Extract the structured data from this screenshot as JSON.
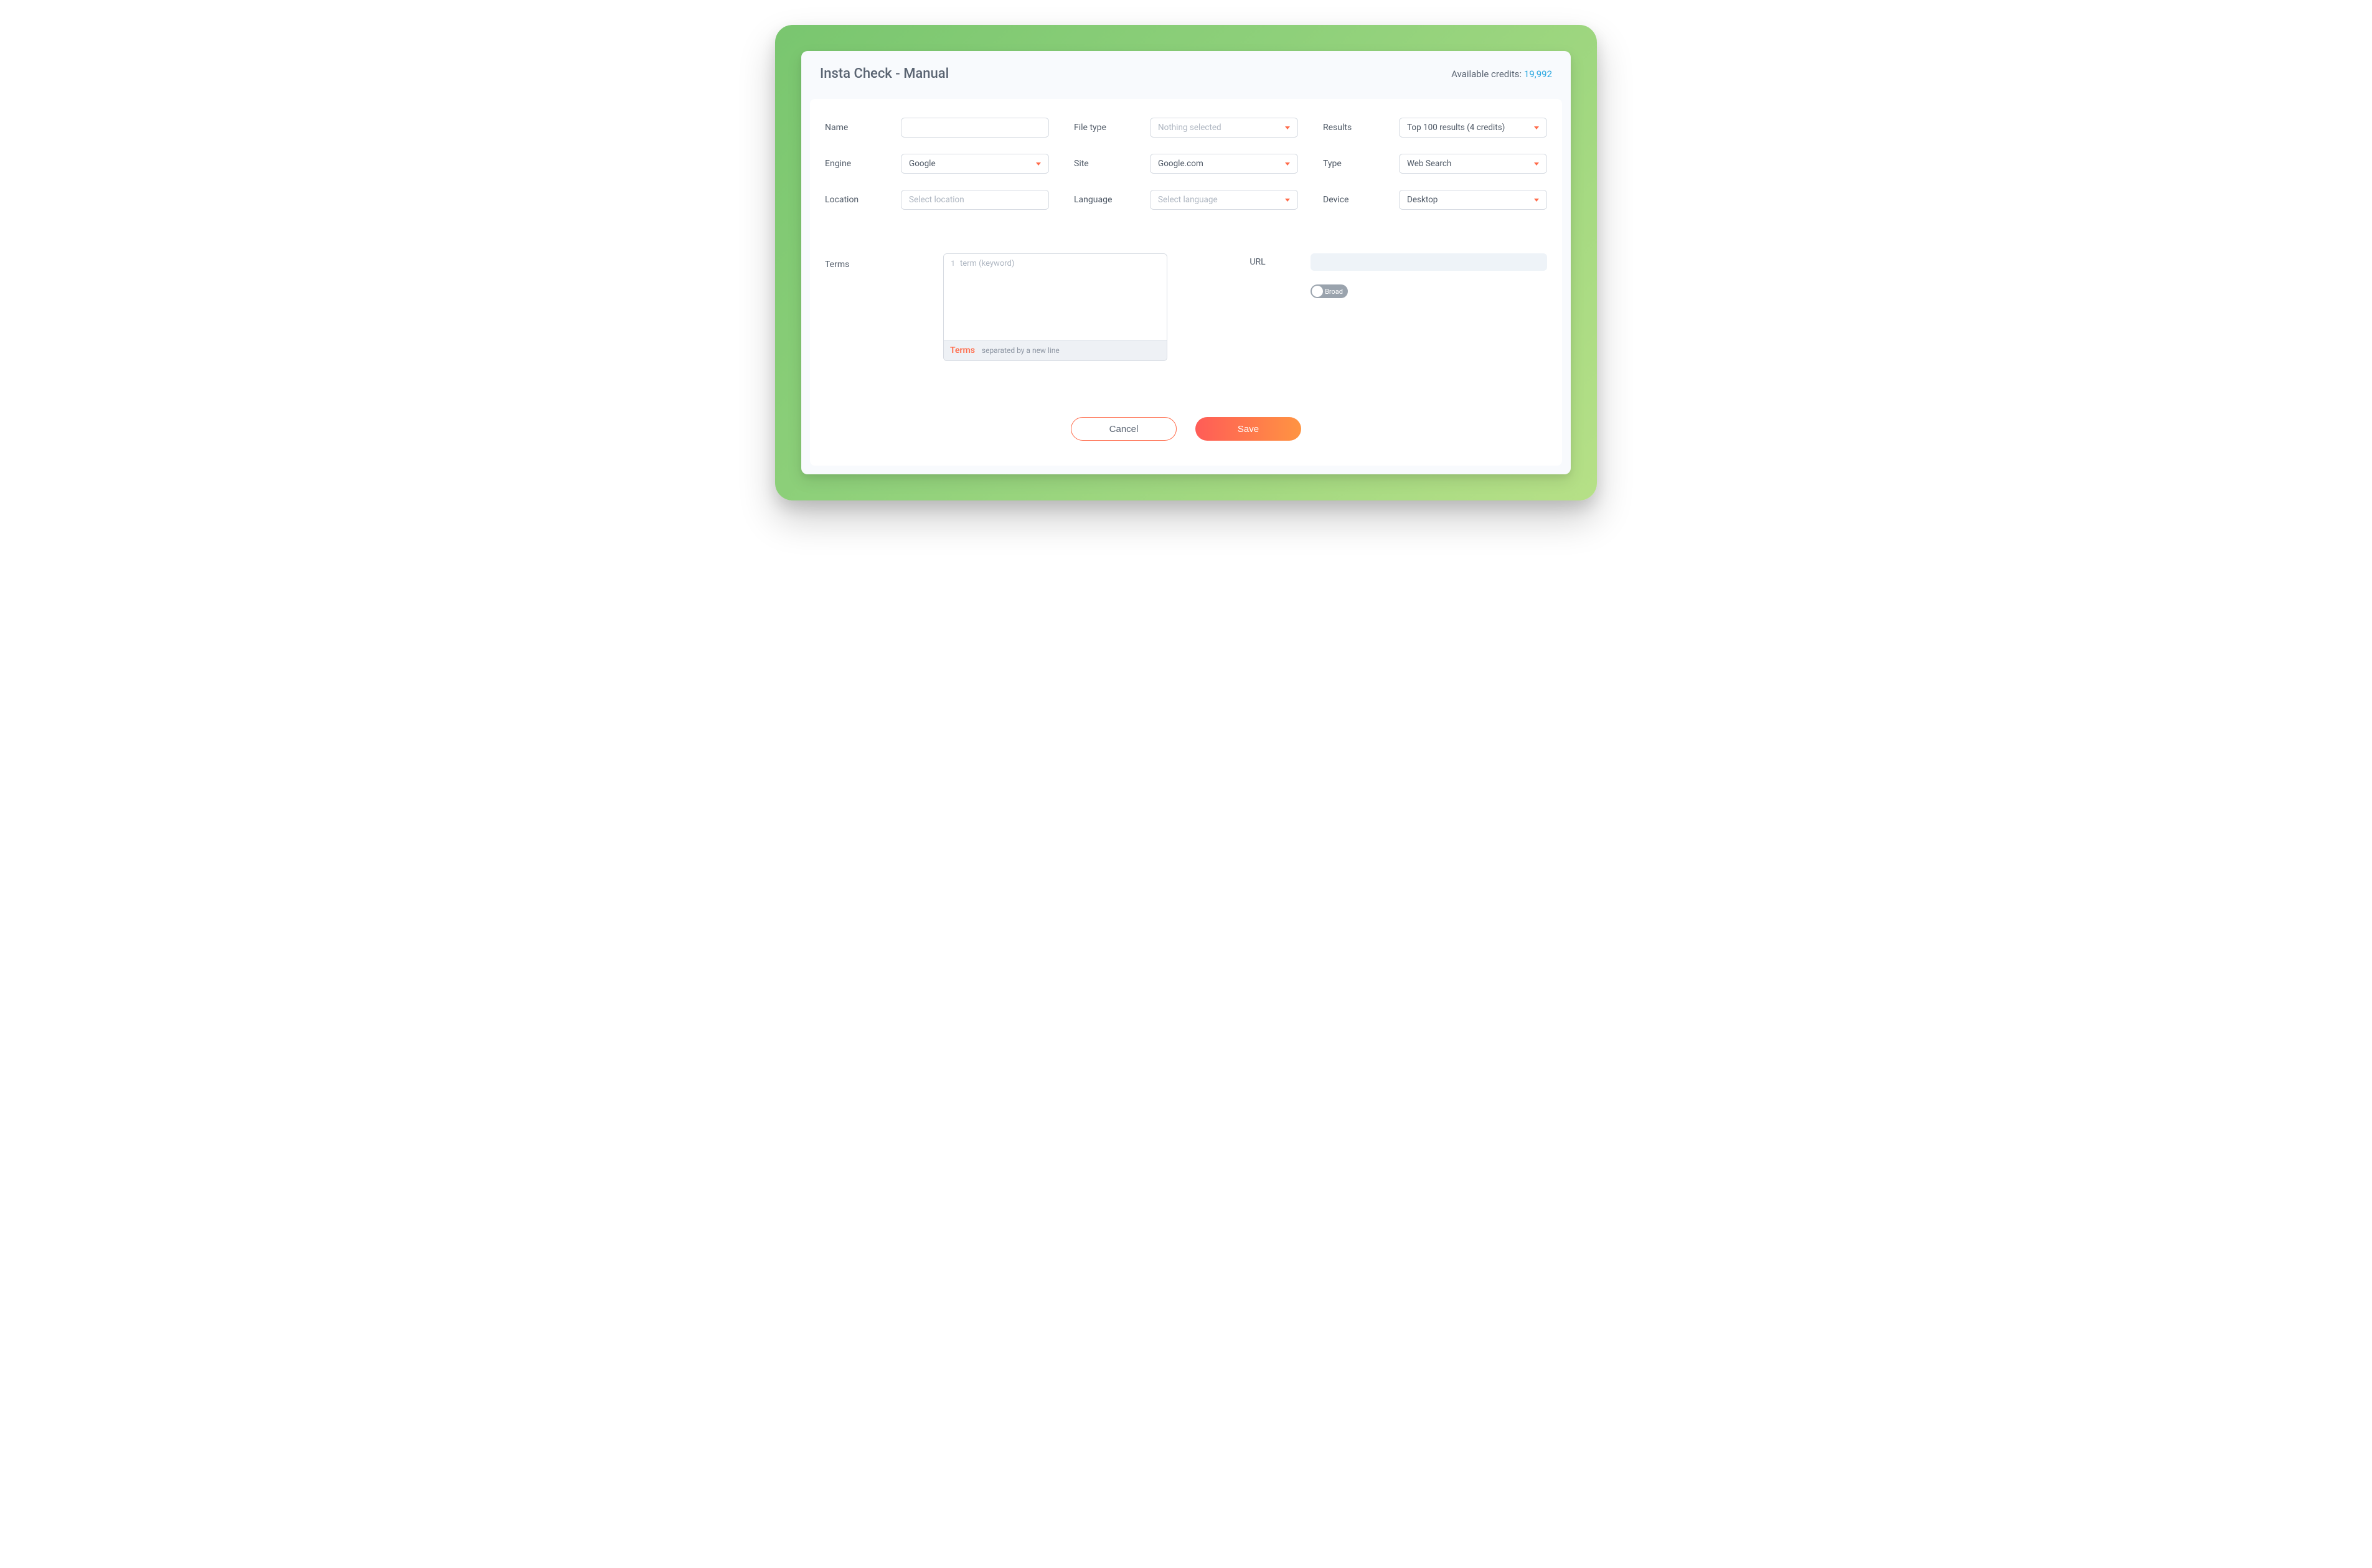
{
  "header": {
    "title": "Insta Check - Manual",
    "credits_label": "Available credits: ",
    "credits_value": "19,992"
  },
  "fields": {
    "name_label": "Name",
    "name_value": "",
    "filetype_label": "File type",
    "filetype_value": "Nothing selected",
    "results_label": "Results",
    "results_value": "Top 100 results (4 credits)",
    "engine_label": "Engine",
    "engine_value": "Google",
    "site_label": "Site",
    "site_value": "Google.com",
    "type_label": "Type",
    "type_value": "Web Search",
    "location_label": "Location",
    "location_placeholder": "Select location",
    "language_label": "Language",
    "language_placeholder": "Select language",
    "device_label": "Device",
    "device_value": "Desktop"
  },
  "terms": {
    "label": "Terms",
    "line": "1",
    "placeholder": "term (keyword)",
    "footer_title": "Terms",
    "footer_hint": "separated by a new line"
  },
  "url": {
    "label": "URL",
    "toggle_label": "Broad"
  },
  "buttons": {
    "cancel": "Cancel",
    "save": "Save"
  }
}
